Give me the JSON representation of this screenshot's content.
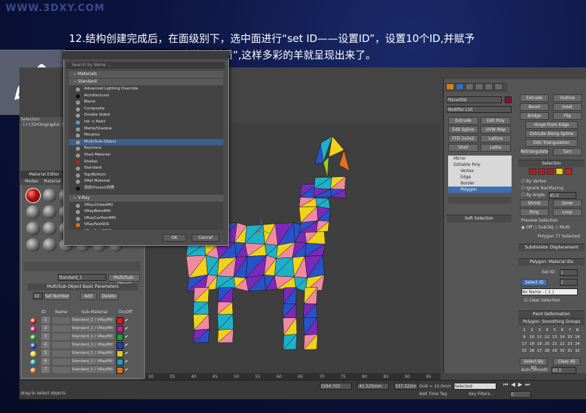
{
  "slide": {
    "logo": "WWW.3DXY.COM",
    "caption_line1": "12.结构创建完成后，在面级别下，选中面进行“set ID——设置ID”，设置10个ID,并赋予",
    "caption_line2": "“Multi/Sub-Object——多维子材质”,这样多彩的羊就呈现出来了。"
  },
  "viewport": {
    "selection_tab": "Selection",
    "left_vp_title": "[+] [Orthographic ] [S",
    "ruler_ticks": [
      "30",
      "35",
      "40",
      "45",
      "50",
      "55",
      "60",
      "65",
      "70",
      "75",
      "80",
      "85",
      "90",
      "95"
    ]
  },
  "browser": {
    "search_placeholder": "Search by Name ...",
    "root": "Materials",
    "cat_standard": "Standard",
    "standard_items": [
      "Advanced Lighting Override",
      "Architectural",
      "Blend",
      "Composite",
      "Double Sided",
      "Ink 'n Paint",
      "Matte/Shadow",
      "Morphor",
      "Multi/Sub-Object",
      "Raytrace",
      "Shell Material",
      "Shellac",
      "Standard",
      "Top/Bottom",
      "XRef Material",
      "双拼(Forest)材质"
    ],
    "selected_item": "Multi/Sub-Object",
    "cat_vray": "V-Ray",
    "vray_items": [
      "VRay2SidedMtl",
      "VRayBlendMtl",
      "VRayCarPaintMtl",
      "VRayFastSSS",
      "VRayFastSSS2"
    ],
    "ok": "OK",
    "cancel": "Cancel"
  },
  "mated": {
    "title": "Material Editor - 0",
    "menu_modes": "Modes",
    "menu_material": "Material",
    "slot_name": "Standard_1",
    "type_button": "Multi/Sub-Object",
    "params_title": "Multi/Sub-Object Basic Parameters",
    "count": "10",
    "set_number": "Set Number",
    "add": "Add",
    "delete": "Delete",
    "col_id": "ID",
    "col_name": "Name",
    "col_sub": "Sub-Material",
    "col_onoff": "On/Off",
    "rows": [
      {
        "id": "1",
        "sub": "Standard_1 ( VRayMtl )",
        "color": "#d32020"
      },
      {
        "id": "2",
        "sub": "Standard_1 ( VRayMtl )",
        "color": "#c02080"
      },
      {
        "id": "3",
        "sub": "Standard_1 ( VRayMtl )",
        "color": "#20a030"
      },
      {
        "id": "4",
        "sub": "Standard_1 ( VRayMtl )",
        "color": "#2040c0"
      },
      {
        "id": "5",
        "sub": "Standard_1 ( VRayMtl )",
        "color": "#e0d020"
      },
      {
        "id": "6",
        "sub": "Standard_1 ( VRayMtl )",
        "color": "#20a0c0"
      },
      {
        "id": "7",
        "sub": "Standard_1 ( VRayMtl )",
        "color": "#e07020"
      }
    ]
  },
  "cmd": {
    "object_name": "Plane006",
    "modifier_list": "Modifier List",
    "left_buttons": [
      "Extrude",
      "Edit Spline",
      "FFD 2x2x2",
      "Shell"
    ],
    "mid_buttons": [
      "Edit Poly",
      "UVW Map",
      "Lattice",
      "Lathe"
    ],
    "stack": [
      "Mirror",
      "Editable Poly",
      "Vertex",
      "Edge",
      "Border",
      "Polygon"
    ],
    "stack_selected": "Polygon",
    "soft_selection": "Soft Selection",
    "edit_poly": [
      [
        "Extrude",
        "Outline"
      ],
      [
        "Bevel",
        "Inset"
      ],
      [
        "Bridge",
        "Flip"
      ]
    ],
    "hinge": "Hinge From Edge",
    "extrude_spline": "Extrude Along Spline",
    "edit_tri": "Edit Triangulation",
    "retriangulate": "Retriangulate",
    "turn": "Turn",
    "selection_head": "Selection",
    "by_vertex": "By Vertex",
    "ignore_backfacing": "Ignore Backfacing",
    "by_angle": "By Angle:",
    "by_angle_val": "45.0",
    "shrink": "Shrink",
    "grow": "Grow",
    "ring": "Ring",
    "loop": "Loop",
    "preview_selection": "Preview Selection",
    "off": "Off",
    "subobj": "SubObj",
    "multi": "Multi",
    "sel_status": "Polygon 77 Selected",
    "subdiv": "Subdivision Displacement",
    "matids_head": "Polygon: Material IDs",
    "set_id": "Set ID:",
    "set_id_val": "1",
    "select_id": "Select ID",
    "select_id_val": "1",
    "no_name": "No Name - ( 1 )",
    "clear_selection": "Clear Selection",
    "paint_deform": "Paint Deformation",
    "smoothing_head": "Polygon: Smoothing Groups",
    "sg_numbers": [
      "1",
      "2",
      "3",
      "4",
      "5",
      "6",
      "7",
      "8",
      "9",
      "10",
      "11",
      "12",
      "13",
      "14",
      "15",
      "16",
      "17",
      "18",
      "19",
      "20",
      "21",
      "22",
      "23",
      "24",
      "25",
      "26",
      "27",
      "28",
      "29",
      "30",
      "31",
      "32"
    ],
    "select_by_sg": "Select By SG",
    "clear_all": "Clear All",
    "auto_smooth": "Auto Smooth",
    "auto_smooth_val": "45.0"
  },
  "status": {
    "text": "drag to select objects",
    "x_val": "1594.702",
    "y_val": "-41.525mm",
    "z_val": "337.522m",
    "grid": "Grid = 10.0mm",
    "add_time_tag": "Add Time Tag",
    "selected": "Selected",
    "key_filters": "Key Filters...",
    "frame": "0"
  },
  "colors": {
    "accent_blue": "#3d5f8a",
    "goat_palette": [
      "#d51f2a",
      "#f0d21a",
      "#1d9a3a",
      "#2a52c8",
      "#c21f8a",
      "#1fb0c8",
      "#e5701f",
      "#7a2ab8",
      "#9ccd2a",
      "#f08aa0"
    ]
  }
}
